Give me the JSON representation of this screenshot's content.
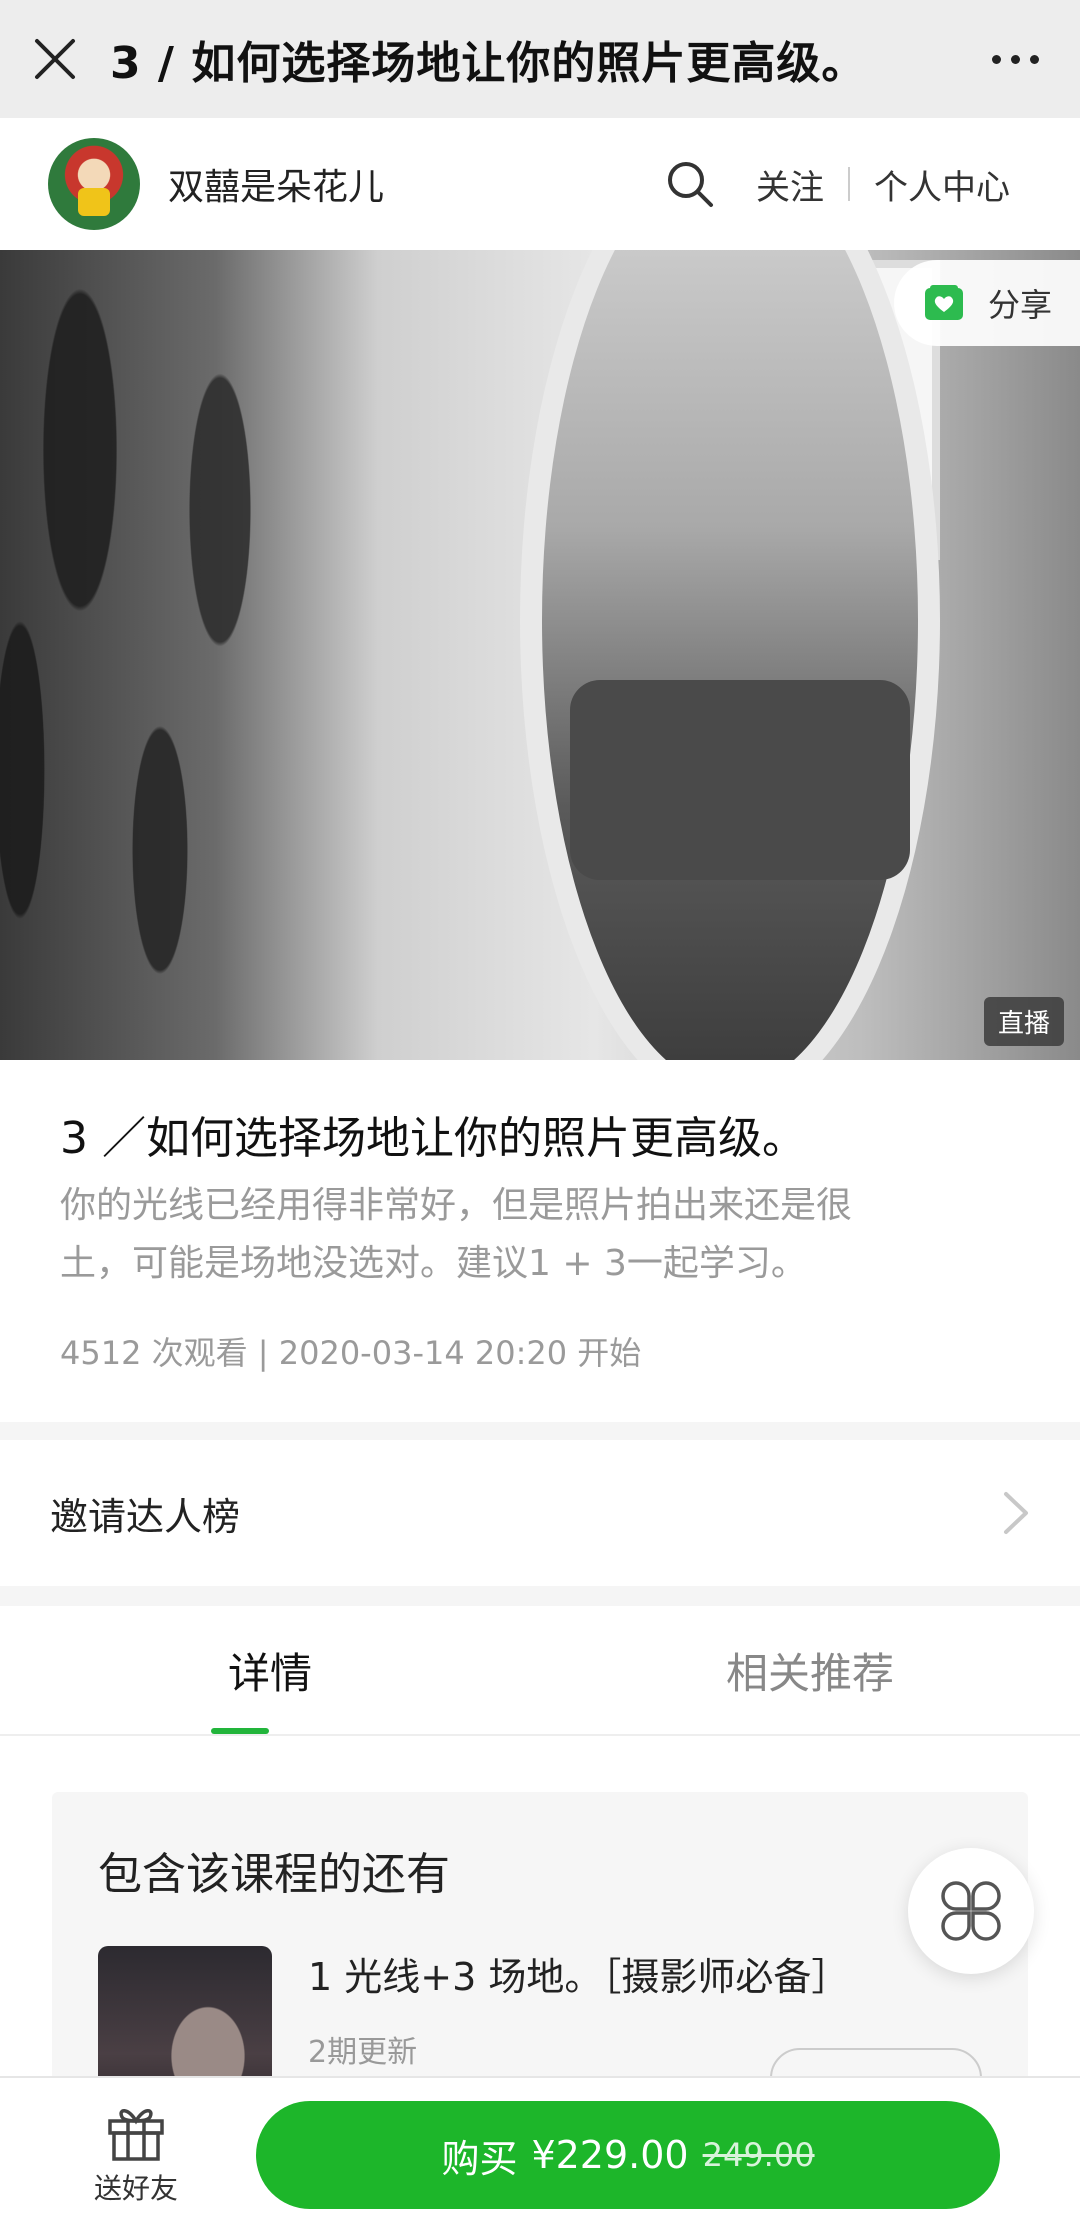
{
  "topbar": {
    "title": "3 / 如何选择场地让你的照片更高级。"
  },
  "author": {
    "name": "双囍是朵花儿",
    "follow_label": "关注",
    "center_label": "个人中心"
  },
  "hero": {
    "share_label": "分享",
    "live_badge": "直播"
  },
  "course": {
    "title": "3 ／如何选择场地让你的照片更高级。",
    "desc_line1": "你的光线已经用得非常好，但是照片拍出来还是很",
    "desc_line2": "土，可能是场地没选对。建议1 + 3一起学习。",
    "meta": "4512 次观看 | 2020-03-14 20:20 开始"
  },
  "invite": {
    "label": "邀请达人榜"
  },
  "tabs": [
    {
      "label": "详情",
      "active": true
    },
    {
      "label": "相关推荐",
      "active": false
    }
  ],
  "detail": {
    "heading": "包含该课程的还有",
    "item": {
      "title": "1 光线+3 场地。［摄影师必备］",
      "sub": "2期更新"
    }
  },
  "bottom": {
    "gift_label": "送好友",
    "buy_label": "购买",
    "price": "¥229.00",
    "original_price": "249.00"
  },
  "colors": {
    "accent_green": "#1db62a",
    "share_green": "#2dbb4f"
  },
  "icons": {
    "close": "close-icon",
    "more": "more-icon",
    "search": "search-icon",
    "share": "share-icon",
    "chevron": "chevron-right-icon",
    "float": "grid-icon",
    "gift": "gift-icon"
  }
}
